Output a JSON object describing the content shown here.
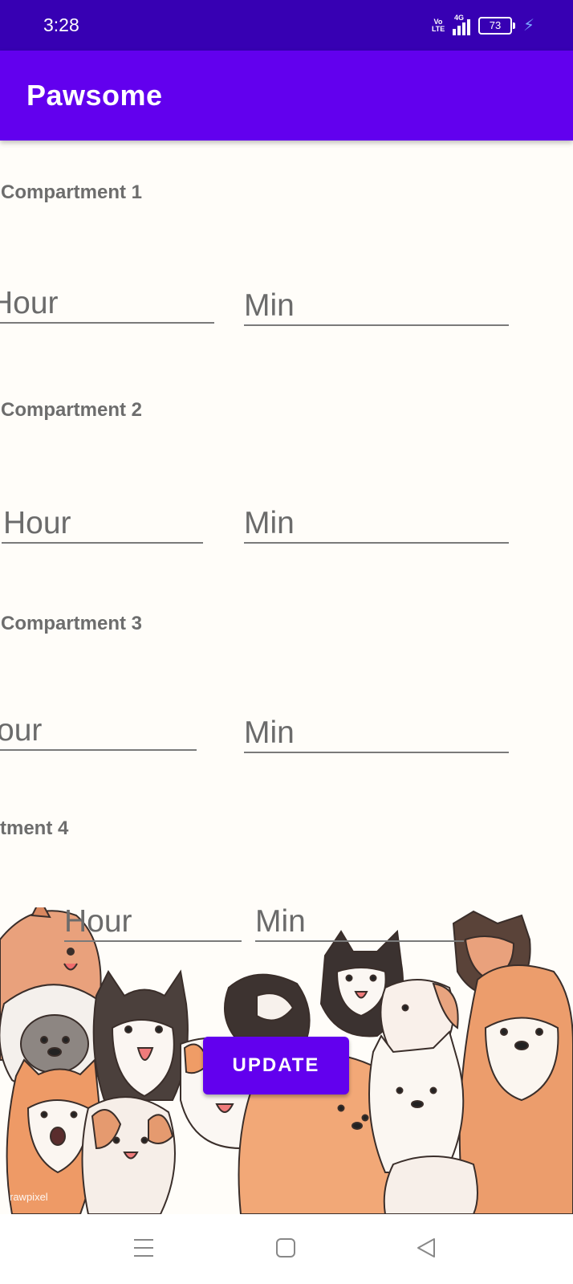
{
  "status_bar": {
    "time": "3:28",
    "volte_label": "Vo LTE",
    "network_label": "4G",
    "battery_level": "73",
    "charging_icon": "bolt-icon"
  },
  "app_bar": {
    "title": "Pawsome"
  },
  "compartments": [
    {
      "label": "Compartment 1",
      "hour_placeholder": "Hour",
      "min_placeholder": "Min"
    },
    {
      "label": "Compartment 2",
      "hour_placeholder": "Hour",
      "min_placeholder": "Min"
    },
    {
      "label": "Compartment 3",
      "hour_placeholder": "our",
      "min_placeholder": "Min"
    },
    {
      "label": "tment 4",
      "hour_placeholder": "Hour",
      "min_placeholder": "Min"
    }
  ],
  "update_button": {
    "label": "UPDATE"
  },
  "illustration": {
    "name": "dogs-illustration",
    "watermark": "rawpixel"
  },
  "nav_bar": {
    "icons": [
      "menu-icon",
      "home-square-icon",
      "back-triangle-icon"
    ]
  },
  "colors": {
    "status_bar": "#3700b3",
    "primary": "#6200ee",
    "background": "#fffdf9",
    "text_muted": "#6d6d6d"
  }
}
